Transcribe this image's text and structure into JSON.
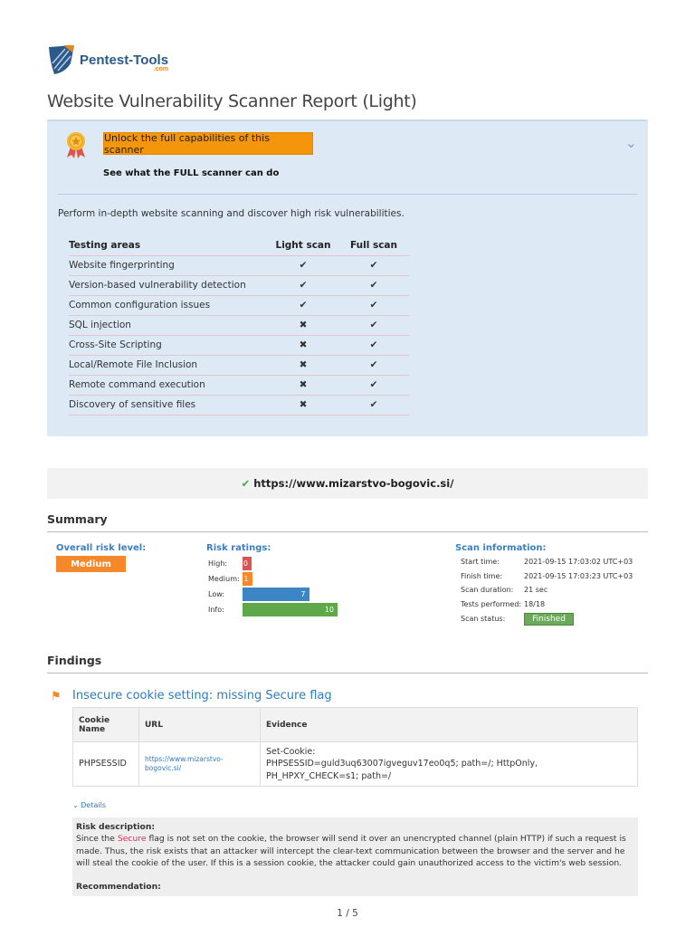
{
  "brand": {
    "name": "Pentest-Tools",
    "suffix": ".com"
  },
  "title": "Website Vulnerability Scanner Report (Light)",
  "promo": {
    "unlock_label": "Unlock the full capabilities of this scanner",
    "see_label": "See what the FULL scanner can do",
    "intro": "Perform in-depth website scanning and discover high risk vulnerabilities.",
    "headers": [
      "Testing areas",
      "Light scan",
      "Full scan"
    ],
    "rows": [
      {
        "area": "Website fingerprinting",
        "light": "✔",
        "full": "✔"
      },
      {
        "area": "Version-based vulnerability detection",
        "light": "✔",
        "full": "✔"
      },
      {
        "area": "Common configuration issues",
        "light": "✔",
        "full": "✔"
      },
      {
        "area": "SQL injection",
        "light": "✖",
        "full": "✔"
      },
      {
        "area": "Cross-Site Scripting",
        "light": "✖",
        "full": "✔"
      },
      {
        "area": "Local/Remote File Inclusion",
        "light": "✖",
        "full": "✔"
      },
      {
        "area": "Remote command execution",
        "light": "✖",
        "full": "✔"
      },
      {
        "area": "Discovery of sensitive files",
        "light": "✖",
        "full": "✔"
      }
    ]
  },
  "target_url": "https://www.mizarstvo-bogovic.si/",
  "summary": {
    "heading": "Summary",
    "overall_label": "Overall risk level:",
    "overall_value": "Medium",
    "ratings_label": "Risk ratings:",
    "ratings": [
      {
        "label": "High:",
        "value": "0",
        "color": "#d9534f"
      },
      {
        "label": "Medium:",
        "value": "1",
        "color": "#f5882a"
      },
      {
        "label": "Low:",
        "value": "7",
        "color": "#3d86c6"
      },
      {
        "label": "Info:",
        "value": "10",
        "color": "#5ea84a"
      }
    ],
    "scan_label": "Scan information:",
    "scan": [
      {
        "k": "Start time:",
        "v": "2021-09-15 17:03:02 UTC+03"
      },
      {
        "k": "Finish time:",
        "v": "2021-09-15 17:03:23 UTC+03"
      },
      {
        "k": "Scan duration:",
        "v": "21 sec"
      },
      {
        "k": "Tests performed:",
        "v": "18/18"
      },
      {
        "k": "Scan status:",
        "v": "Finished"
      }
    ]
  },
  "findings": {
    "heading": "Findings",
    "title": "Insecure cookie setting: missing Secure flag",
    "headers": [
      "Cookie Name",
      "URL",
      "Evidence"
    ],
    "row": {
      "name": "PHPSESSID",
      "url": "https://www.mizarstvo-bogovic.si/",
      "evidence1": "Set-Cookie:",
      "evidence2": "PHPSESSID=guld3uq63007igveguv17eo0q5; path=/; HttpOnly, PH_HPXY_CHECK=s1; path=/"
    },
    "details_label": "Details",
    "risk_label": "Risk description:",
    "risk_pre": "Since the",
    "risk_code": "Secure",
    "risk_post": "flag is not set on the cookie, the browser will send it over an unencrypted channel (plain HTTP) if such a request is made. Thus, the risk exists that an attacker will intercept the clear-text communication between the browser and the server and he will steal the cookie of the user. If this is a session cookie, the attacker could gain unauthorized access to the victim's web session.",
    "rec_label": "Recommendation:"
  },
  "page": "1 / 5"
}
